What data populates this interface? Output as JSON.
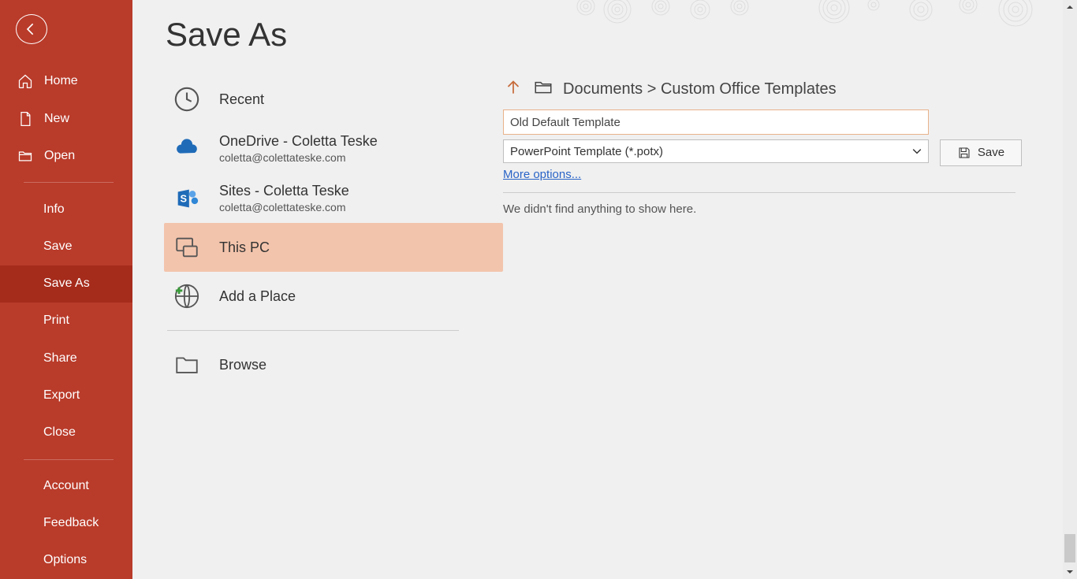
{
  "page": {
    "title": "Save As"
  },
  "sidebar": {
    "home": "Home",
    "new": "New",
    "open": "Open",
    "info": "Info",
    "save": "Save",
    "saveas": "Save As",
    "print": "Print",
    "share": "Share",
    "export": "Export",
    "close": "Close",
    "account": "Account",
    "feedback": "Feedback",
    "options": "Options"
  },
  "locations": {
    "recent": {
      "label": "Recent"
    },
    "onedrive": {
      "label": "OneDrive - Coletta Teske",
      "sub": "coletta@colettateske.com"
    },
    "sites": {
      "label": "Sites - Coletta Teske",
      "sub": "coletta@colettateske.com"
    },
    "thispc": {
      "label": "This PC"
    },
    "addplace": {
      "label": "Add a Place"
    },
    "browse": {
      "label": "Browse"
    }
  },
  "breadcrumb": {
    "text": "Documents > Custom Office Templates"
  },
  "filename": {
    "value": "Old Default Template"
  },
  "filetype": {
    "selected": "PowerPoint Template (*.potx)"
  },
  "moreoptions": "More options...",
  "saveButton": "Save",
  "emptyMsg": "We didn't find anything to show here.",
  "colors": {
    "sidebar_bg": "#b93b2a",
    "sidebar_active": "#a52b1b",
    "location_selected": "#f3c4ac",
    "accent_link": "#2a64c7"
  }
}
